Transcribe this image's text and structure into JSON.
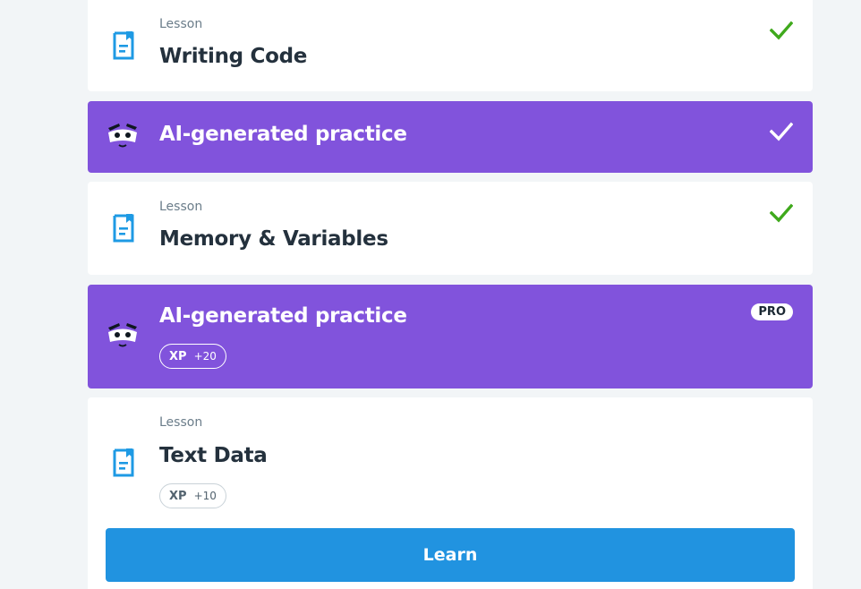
{
  "colors": {
    "page_bg": "#f2f5f7",
    "card_bg": "#ffffff",
    "ai_card_bg": "#8153dc",
    "check_green": "#3fa91c",
    "accent_blue": "#2193e0",
    "title_text": "#24313d"
  },
  "items": [
    {
      "type": "lesson",
      "kicker": "Lesson",
      "title": "Writing Code",
      "icon": "lesson-document-icon",
      "status": "completed"
    },
    {
      "type": "ai-practice",
      "title": "AI-generated practice",
      "icon": "ai-mascot-icon",
      "status": "completed"
    },
    {
      "type": "lesson",
      "kicker": "Lesson",
      "title": "Memory & Variables",
      "icon": "lesson-document-icon",
      "status": "completed"
    },
    {
      "type": "ai-practice",
      "title": "AI-generated practice",
      "icon": "ai-mascot-icon",
      "badge": "PRO",
      "xp_label": "XP",
      "xp_value": "+20"
    },
    {
      "type": "lesson",
      "kicker": "Lesson",
      "title": "Text Data",
      "icon": "lesson-document-icon",
      "xp_label": "XP",
      "xp_value": "+10",
      "action_label": "Learn"
    }
  ]
}
